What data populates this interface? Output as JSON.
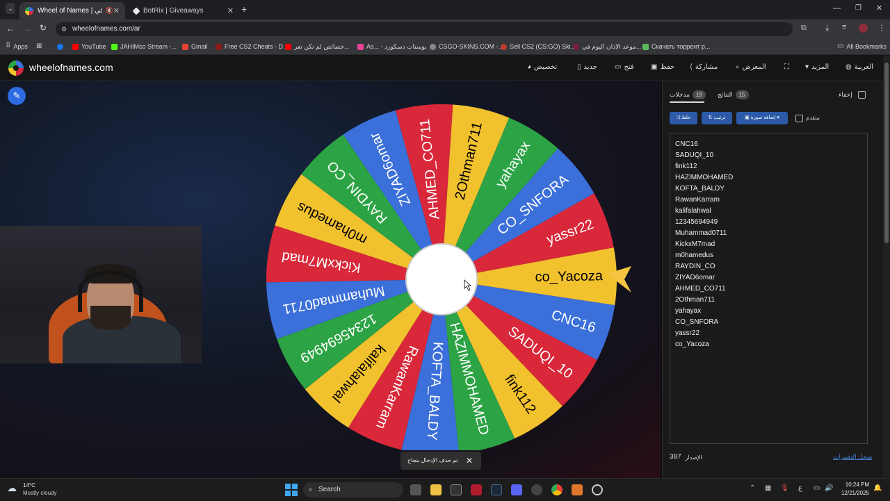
{
  "browser": {
    "tabs": [
      {
        "title": "Wheel of Names | العشوائي",
        "active": true
      },
      {
        "title": "BotRix | Giveaways",
        "active": false
      }
    ],
    "new_tab": "+",
    "url": "wheelofnames.com/ar",
    "bookmarks": [
      {
        "label": "Apps",
        "color": "#4285f4"
      },
      {
        "label": "YouTube",
        "color": "#ff0000"
      },
      {
        "label": "JAHIMco Stream -...",
        "color": "#53fc18"
      },
      {
        "label": "Gmail",
        "color": "#ea4335"
      },
      {
        "label": "Free CS2 Cheats - D...",
        "color": "#8b1a1a"
      },
      {
        "label": "خصائص لم تكن تعر...",
        "color": "#ff0000"
      },
      {
        "label": "As... - بوستات دسكورد",
        "color": "#e84393"
      },
      {
        "label": "CSGO-SKINS.COM -...",
        "color": "#888888"
      },
      {
        "label": "Sell CS2 (CS:GO) Ski...",
        "color": "#c0392b"
      },
      {
        "label": "موعد الاذان اليوم في...",
        "color": "#7b1e3a"
      },
      {
        "label": "Скачать торрент р...",
        "color": "#5cb85c"
      }
    ],
    "all_bookmarks": "All Bookmarks"
  },
  "site": {
    "logo": "wheelofnames.com",
    "nav": [
      {
        "label": "تخصيص",
        "icon": "palette-icon"
      },
      {
        "label": "جديد",
        "icon": "file-icon"
      },
      {
        "label": "فتح",
        "icon": "folder-icon"
      },
      {
        "label": "حفظ",
        "icon": "save-icon"
      },
      {
        "label": "مشاركة",
        "icon": "share-icon"
      },
      {
        "label": "المعرض",
        "icon": "search-icon"
      },
      {
        "label": "",
        "icon": "fullscreen-icon"
      },
      {
        "label": "المزيد",
        "icon": "chevron-down-icon"
      },
      {
        "label": "العربية",
        "icon": "globe-icon"
      }
    ]
  },
  "wheel": {
    "pointer_color": "#f5c542",
    "segments": [
      {
        "name": "CNC16",
        "color": "#3b6fd9"
      },
      {
        "name": "SADUQI_10",
        "color": "#d8283a"
      },
      {
        "name": "fink112",
        "color": "#f2c12e"
      },
      {
        "name": "HAZIMMOHAMED",
        "color": "#2ca344"
      },
      {
        "name": "KOFTA_BALDY",
        "color": "#3b6fd9"
      },
      {
        "name": "RawanKarram",
        "color": "#d8283a"
      },
      {
        "name": "kalifalahwal",
        "color": "#f2c12e"
      },
      {
        "name": "12345694949",
        "color": "#2ca344"
      },
      {
        "name": "Muhammad0711",
        "color": "#3b6fd9"
      },
      {
        "name": "KickxM7mad",
        "color": "#d8283a"
      },
      {
        "name": "m0hamedus",
        "color": "#f2c12e"
      },
      {
        "name": "RAYDIN_CO",
        "color": "#2ca344"
      },
      {
        "name": "ZIYAD6omar",
        "color": "#3b6fd9"
      },
      {
        "name": "AHMED_CO711",
        "color": "#d8283a"
      },
      {
        "name": "2Othman711",
        "color": "#f2c12e"
      },
      {
        "name": "yahayax",
        "color": "#2ca344"
      },
      {
        "name": "CO_SNFORA",
        "color": "#3b6fd9"
      },
      {
        "name": "yassr22",
        "color": "#d8283a"
      },
      {
        "name": "co_Yacoza",
        "color": "#f2c12e"
      }
    ]
  },
  "panel": {
    "hide_label": "إخفاء",
    "tabs": [
      {
        "label": "مدخلات",
        "count": "19",
        "active": true
      },
      {
        "label": "النتائج",
        "count": "15",
        "active": false
      }
    ],
    "shuffle": "خلط",
    "sort": "ترتيب",
    "add_image": "إضافة صورة",
    "advanced": "متقدم",
    "entries": [
      "CNC16",
      "SADUQI_10",
      "fink112",
      "HAZIMMOHAMED",
      "KOFTA_BALDY",
      "RawanKarram",
      "kalifalahwal",
      "12345694949",
      "Muhammad0711",
      "KickxM7mad",
      "m0hamedus",
      "RAYDIN_CO",
      "ZIYAD6omar",
      "AHMED_CO711",
      "2Othman711",
      "yahayax",
      "CO_SNFORA",
      "yassr22",
      "co_Yacoza"
    ],
    "version_label": "الإصدار",
    "version": "387",
    "changelog": "سجل التغييرات"
  },
  "toast": {
    "text": "تم حذف الإدخال بنجاح",
    "close": "✕"
  },
  "taskbar": {
    "weather_temp": "14°C",
    "weather_desc": "Mostly cloudy",
    "search": "Search",
    "time": "10:24 PM",
    "date": "12/21/2025",
    "lang": "ع"
  }
}
